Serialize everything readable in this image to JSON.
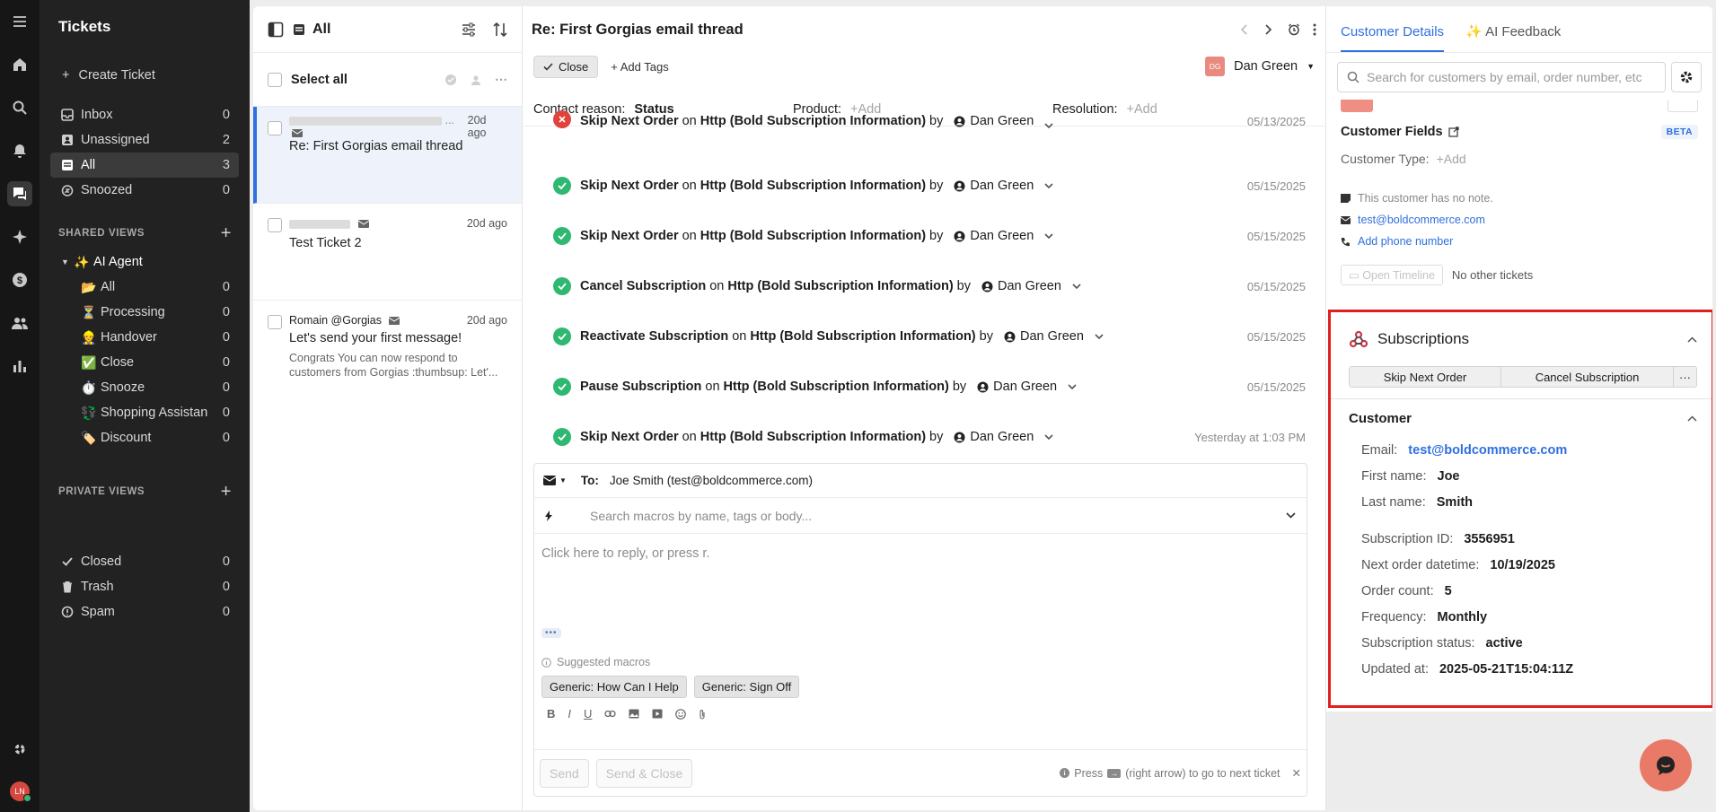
{
  "nav": {
    "title": "Tickets",
    "create": "Create Ticket",
    "views": [
      {
        "label": "Inbox",
        "count": "0"
      },
      {
        "label": "Unassigned",
        "count": "2"
      },
      {
        "label": "All",
        "count": "3"
      },
      {
        "label": "Snoozed",
        "count": "0"
      }
    ],
    "shared_header": "SHARED VIEWS",
    "ai_agent": "AI Agent",
    "ai_views": [
      {
        "emoji": "📂",
        "label": "All",
        "count": "0"
      },
      {
        "emoji": "⏳",
        "label": "Processing",
        "count": "0"
      },
      {
        "emoji": "👷",
        "label": "Handover",
        "count": "0"
      },
      {
        "emoji": "✅",
        "label": "Close",
        "count": "0"
      },
      {
        "emoji": "⏱️",
        "label": "Snooze",
        "count": "0"
      },
      {
        "emoji": "💱",
        "label": "Shopping Assistan",
        "count": "0"
      },
      {
        "emoji": "🏷️",
        "label": "Discount",
        "count": "0"
      }
    ],
    "private_header": "PRIVATE VIEWS",
    "bottom": [
      {
        "label": "Closed",
        "count": "0"
      },
      {
        "label": "Trash",
        "count": "0"
      },
      {
        "label": "Spam",
        "count": "0"
      }
    ],
    "user_initials": "LN"
  },
  "list": {
    "title": "All",
    "select_all": "Select all",
    "tickets": [
      {
        "time": "20d ago",
        "subject": "Re: First Gorgias email thread"
      },
      {
        "time": "20d ago",
        "subject": "Test Ticket 2"
      },
      {
        "sender": "Romain @Gorgias",
        "time": "20d ago",
        "subject": "Let's send your first message!",
        "preview": "Congrats         You can now respond to customers from Gorgias :thumbsup: Let'..."
      }
    ]
  },
  "conversation": {
    "subject": "Re: First Gorgias email thread",
    "close": "Close",
    "add_tags": "Add Tags",
    "assignee_initials": "DG",
    "assignee": "Dan Green",
    "fields": {
      "contact_label": "Contact reason:",
      "contact_value": "Status",
      "product_label": "Product:",
      "product_value": "+Add",
      "resolution_label": "Resolution:",
      "resolution_value": "+Add"
    },
    "events": [
      {
        "action": "Skip Next Order",
        "on": "on",
        "target": "Http (Bold Subscription Information)",
        "by": "by",
        "user": "Dan Green",
        "date": "05/13/2025",
        "status": "error"
      },
      {
        "action": "Skip Next Order",
        "on": "on",
        "target": "Http (Bold Subscription Information)",
        "by": "by",
        "user": "Dan Green",
        "date": "05/15/2025",
        "status": "ok"
      },
      {
        "action": "Skip Next Order",
        "on": "on",
        "target": "Http (Bold Subscription Information)",
        "by": "by",
        "user": "Dan Green",
        "date": "05/15/2025",
        "status": "ok"
      },
      {
        "action": "Cancel Subscription",
        "on": "on",
        "target": "Http (Bold Subscription Information)",
        "by": "by",
        "user": "Dan Green",
        "date": "05/15/2025",
        "status": "ok"
      },
      {
        "action": "Reactivate Subscription",
        "on": "on",
        "target": "Http (Bold Subscription Information)",
        "by": "by",
        "user": "Dan Green",
        "date": "05/15/2025",
        "status": "ok"
      },
      {
        "action": "Pause Subscription",
        "on": "on",
        "target": "Http (Bold Subscription Information)",
        "by": "by",
        "user": "Dan Green",
        "date": "05/15/2025",
        "status": "ok"
      },
      {
        "action": "Skip Next Order",
        "on": "on",
        "target": "Http (Bold Subscription Information)",
        "by": "by",
        "user": "Dan Green",
        "date": "Yesterday at 1:03 PM",
        "status": "ok"
      }
    ],
    "reply": {
      "to_label": "To:",
      "to_value": "Joe Smith (test@boldcommerce.com)",
      "macro_placeholder": "Search macros by name, tags or body...",
      "body_placeholder": "Click here to reply, or press r.",
      "suggested": "Suggested macros",
      "macros": [
        "Generic: How Can I Help",
        "Generic: Sign Off"
      ],
      "send": "Send",
      "send_close": "Send & Close",
      "hint_pre": "Press",
      "hint_post": "(right arrow) to go to next ticket"
    }
  },
  "sidebar": {
    "tabs": [
      "Customer Details",
      "AI Feedback"
    ],
    "search_placeholder": "Search for customers by email, order number, etc",
    "customer_fields": "Customer Fields",
    "beta": "BETA",
    "customer_type_label": "Customer Type:",
    "customer_type_value": "+Add",
    "note": "This customer has no note.",
    "email": "test@boldcommerce.com",
    "add_phone": "Add phone number",
    "open_timeline": "Open Timeline",
    "no_tickets": "No other tickets",
    "subscriptions": {
      "title": "Subscriptions",
      "actions": [
        "Skip Next Order",
        "Cancel Subscription"
      ],
      "customer_header": "Customer",
      "rows": [
        {
          "k": "Email:",
          "v": "test@boldcommerce.com"
        },
        {
          "k": "First name:",
          "v": "Joe"
        },
        {
          "k": "Last name:",
          "v": "Smith"
        },
        {
          "k": "Subscription ID:",
          "v": "3556951"
        },
        {
          "k": "Next order datetime:",
          "v": "10/19/2025"
        },
        {
          "k": "Order count:",
          "v": "5"
        },
        {
          "k": "Frequency:",
          "v": "Monthly"
        },
        {
          "k": "Subscription status:",
          "v": "active"
        },
        {
          "k": "Updated at:",
          "v": "2025-05-21T15:04:11Z"
        }
      ]
    }
  }
}
